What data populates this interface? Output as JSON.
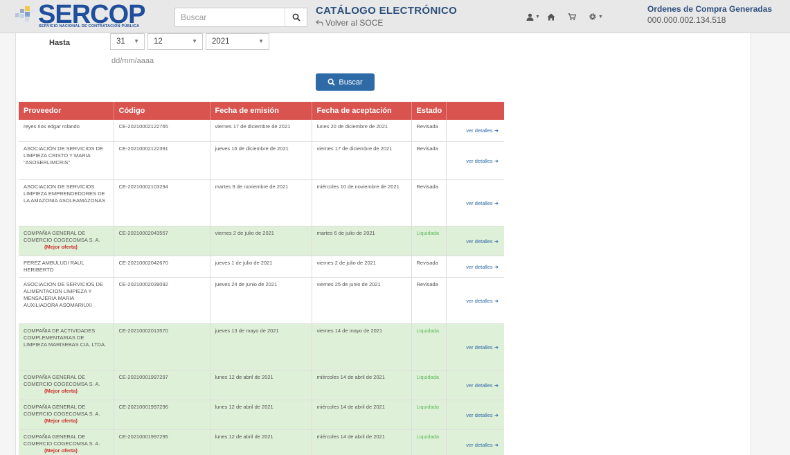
{
  "header": {
    "logo_text": "SERCOP",
    "logo_sub": "SERVICIO NACIONAL DE CONTRATACIÓN PÚBLICA",
    "search_placeholder": "Buscar",
    "catalog_title": "CATÁLOGO ELECTRÓNICO",
    "back_link": "Volver al SOCE",
    "orders_title": "Ordenes de Compra Generadas",
    "orders_number": "000.000.002.134.518",
    "icons": [
      "user-icon",
      "home-icon",
      "cart-icon",
      "gear-icon"
    ]
  },
  "filter": {
    "hasta_label": "Hasta",
    "day": "31",
    "month": "12",
    "year": "2021",
    "hint": "dd/mm/aaaa",
    "search_button": "Buscar"
  },
  "table": {
    "headers": [
      "Proveedor",
      "Código",
      "Fecha de emisión",
      "Fecha de aceptación",
      "Estado"
    ],
    "details_label": "ver detalles",
    "best_offer_label": "(Mejor oferta)",
    "rows": [
      {
        "proveedor": "reyes rios edgar rolando",
        "codigo": "CE-20210002122765",
        "emision": "viernes 17 de diciembre de 2021",
        "aceptacion": "lunes 20 de diciembre de 2021",
        "estado": "Revisada",
        "liquidada": false,
        "mejor": false
      },
      {
        "proveedor": "ASOCIACIÓN DE SERVICIOS DE LIMPIEZA CRISTO Y MARIA \"ASOSERLIMCRIS\"",
        "codigo": "CE-20210002122391",
        "emision": "jueves 16 de diciembre de 2021",
        "aceptacion": "viernes 17 de diciembre de 2021",
        "estado": "Revisada",
        "liquidada": false,
        "mejor": false
      },
      {
        "proveedor": "ASOCIACION DE SERVICIOS LIMPIEZA EMPRENDEDORES DE LA AMAZONIA ASOLEAMAZONAS",
        "codigo": "CE-20210002103294",
        "emision": "martes 9 de noviembre de 2021",
        "aceptacion": "miércoles 10 de noviembre de 2021",
        "estado": "Revisada",
        "liquidada": false,
        "mejor": false
      },
      {
        "proveedor": "COMPAÑIA GENERAL DE COMERCIO COGECOMSA S. A.",
        "codigo": "CE-20210002043557",
        "emision": "viernes 2 de julio de 2021",
        "aceptacion": "martes 6 de julio de 2021",
        "estado": "Liquidada",
        "liquidada": true,
        "mejor": true
      },
      {
        "proveedor": "PEREZ AMBULUDI RAUL HERIBERTO",
        "codigo": "CE-20210002042670",
        "emision": "jueves 1 de julio de 2021",
        "aceptacion": "viernes 2 de julio de 2021",
        "estado": "Revisada",
        "liquidada": false,
        "mejor": false
      },
      {
        "proveedor": "ASOCIACION DE SERVICIOS DE ALIMENTACION LIMPIEZA Y MENSAJERIA MARIA AUXILIADORA ASOMARIUXI",
        "codigo": "CE-20210002039092",
        "emision": "jueves 24 de junio de 2021",
        "aceptacion": "viernes 25 de junio de 2021",
        "estado": "Revisada",
        "liquidada": false,
        "mejor": false
      },
      {
        "proveedor": "COMPAÑIA DE ACTIVIDADES COMPLEMENTARIAS DE LIMPIEZA MARISEBAS CIA. LTDA.",
        "codigo": "CE-20210002013570",
        "emision": "jueves 13 de mayo de 2021",
        "aceptacion": "viernes 14 de mayo de 2021",
        "estado": "Liquidada",
        "liquidada": true,
        "mejor": false
      },
      {
        "proveedor": "COMPAÑIA GENERAL DE COMERCIO COGECOMSA S. A.",
        "codigo": "CE-20210001997297",
        "emision": "lunes 12 de abril de 2021",
        "aceptacion": "miércoles 14 de abril de 2021",
        "estado": "Liquidada",
        "liquidada": true,
        "mejor": true
      },
      {
        "proveedor": "COMPAÑIA GENERAL DE COMERCIO COGECOMSA S. A.",
        "codigo": "CE-20210001997296",
        "emision": "lunes 12 de abril de 2021",
        "aceptacion": "miércoles 14 de abril de 2021",
        "estado": "Liquidada",
        "liquidada": true,
        "mejor": true
      },
      {
        "proveedor": "COMPAÑIA GENERAL DE COMERCIO COGECOMSA S. A.",
        "codigo": "CE-20210001997295",
        "emision": "lunes 12 de abril de 2021",
        "aceptacion": "miércoles 14 de abril de 2021",
        "estado": "Liquidada",
        "liquidada": true,
        "mejor": true
      }
    ]
  },
  "colors": {
    "brand": "#1f4e9c",
    "table_header": "#d9534f",
    "liquidada_row": "#dff0d8",
    "liquidada_text": "#5cb85c",
    "primary_button": "#2d6aa6"
  }
}
